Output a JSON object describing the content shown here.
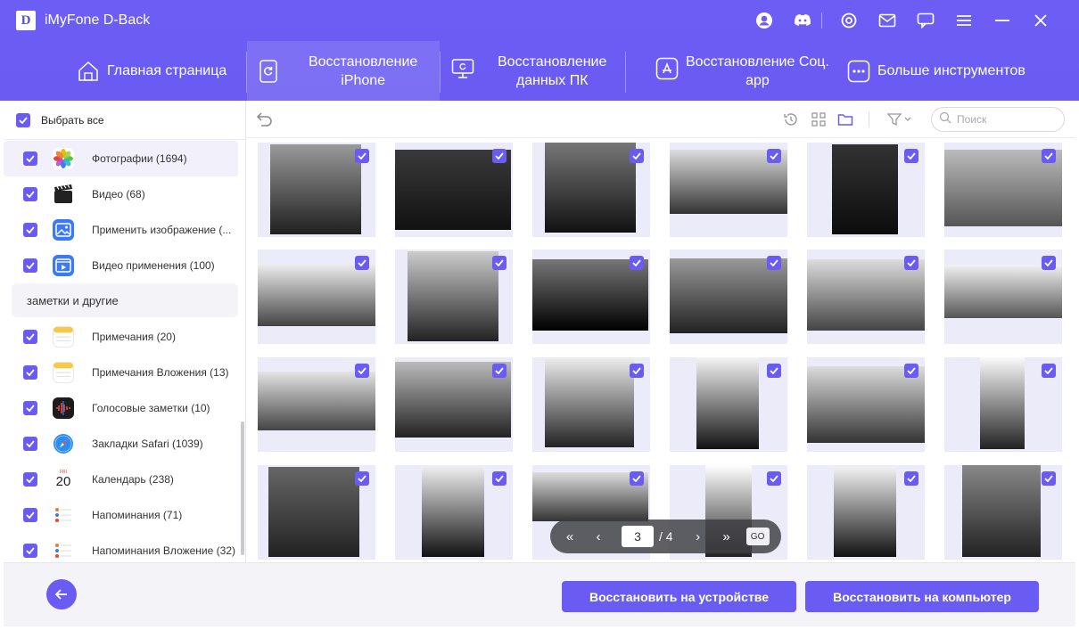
{
  "app": {
    "logo_letter": "D",
    "title": "iMyFone D-Back"
  },
  "titlebar_icons": [
    "account-icon",
    "discord-icon",
    "target-icon",
    "mail-icon",
    "chat-icon",
    "menu-icon",
    "minimize-icon",
    "close-icon"
  ],
  "nav": {
    "tabs": [
      {
        "label": "Главная страница",
        "icon": "home-icon",
        "active": false
      },
      {
        "label": "Восстановление iPhone",
        "icon": "iphone-restore-icon",
        "active": true
      },
      {
        "label_line1": "Восстановление",
        "label_line2": "данных ПК",
        "icon": "pc-icon",
        "active": false
      },
      {
        "label_line1": "Восстановление Соц.",
        "label_line2": "app",
        "icon": "app-store-icon",
        "active": false
      },
      {
        "label": "Больше инструментов",
        "icon": "more-tools-icon",
        "active": false
      }
    ]
  },
  "sidebar": {
    "select_all_label": "Выбрать все",
    "items": [
      {
        "label": "Фотографии (1694)",
        "icon": "photos-icon",
        "checked": true,
        "selected": true
      },
      {
        "label": "Видео (68)",
        "icon": "video-icon",
        "checked": true
      },
      {
        "label": "Применить изображение (...",
        "icon": "app-image-icon",
        "checked": true
      },
      {
        "label": "Видео применения (100)",
        "icon": "app-video-icon",
        "checked": true
      },
      {
        "label": "Примечания (20)",
        "icon": "notes-icon",
        "checked": true
      },
      {
        "label": "Примечания Вложения (13)",
        "icon": "notes-attachments-icon",
        "checked": true
      },
      {
        "label": "Голосовые заметки (10)",
        "icon": "voice-memos-icon",
        "checked": true
      },
      {
        "label": "Закладки Safari (1039)",
        "icon": "safari-icon",
        "checked": true
      },
      {
        "label": "Календарь (238)",
        "icon": "calendar-icon",
        "checked": true
      },
      {
        "label": "Напоминания (71)",
        "icon": "reminders-icon",
        "checked": true
      },
      {
        "label": "Напоминания Вложение (32)",
        "icon": "reminders-attachments-icon",
        "checked": true
      }
    ],
    "group_label": "заметки и другие",
    "calendar_day": "20",
    "calendar_weekday": "FRI"
  },
  "toolbar": {
    "icons": [
      "undo-icon",
      "history-icon",
      "grid-view-icon",
      "folder-view-icon",
      "filter-icon"
    ],
    "search_placeholder": "Поиск"
  },
  "photos": {
    "count": 24,
    "all_checked": true
  },
  "pager": {
    "current_page": "3",
    "total_label": "/ 4",
    "go_label": "GO"
  },
  "footer": {
    "restore_device_label": "Восстановить на устройстве",
    "restore_computer_label": "Восстановить на компьютер"
  },
  "colors": {
    "accent": "#6a5cf2",
    "header_bg": "#6c5ef5",
    "cell_bg": "#ecebf9",
    "footer_bg": "#f3f3f8"
  }
}
